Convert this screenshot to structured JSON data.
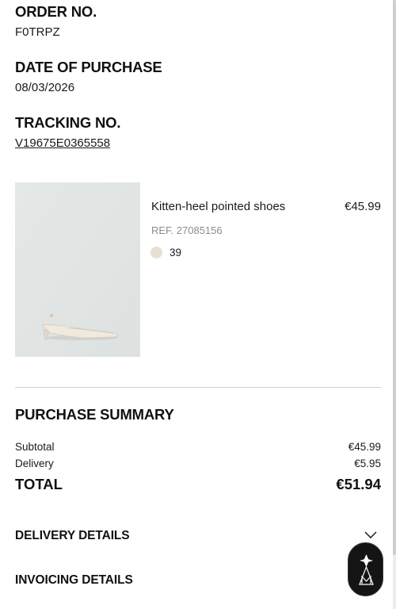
{
  "order": {
    "label": "ORDER NO.",
    "value": "F0TRPZ"
  },
  "purchase_date": {
    "label": "DATE OF PURCHASE",
    "value": "08/03/2026"
  },
  "tracking": {
    "label": "TRACKING NO.",
    "value": "V19675E0365558"
  },
  "product": {
    "name": "Kitten-heel pointed shoes",
    "price": "€45.99",
    "ref": "REF. 27085156",
    "color_swatch": "#e7e1d2",
    "size": "39"
  },
  "summary": {
    "title": "PURCHASE SUMMARY",
    "subtotal_label": "Subtotal",
    "subtotal_value": "€45.99",
    "delivery_label": "Delivery",
    "delivery_value": "€5.95",
    "total_label": "TOTAL",
    "total_value": "€51.94"
  },
  "sections": {
    "delivery_details": "DELIVERY DETAILS",
    "invoicing_details": "INVOICING DETAILS"
  },
  "icons": {
    "chevron": "chevron-down-icon",
    "fab": "assistant-logo-icon"
  }
}
